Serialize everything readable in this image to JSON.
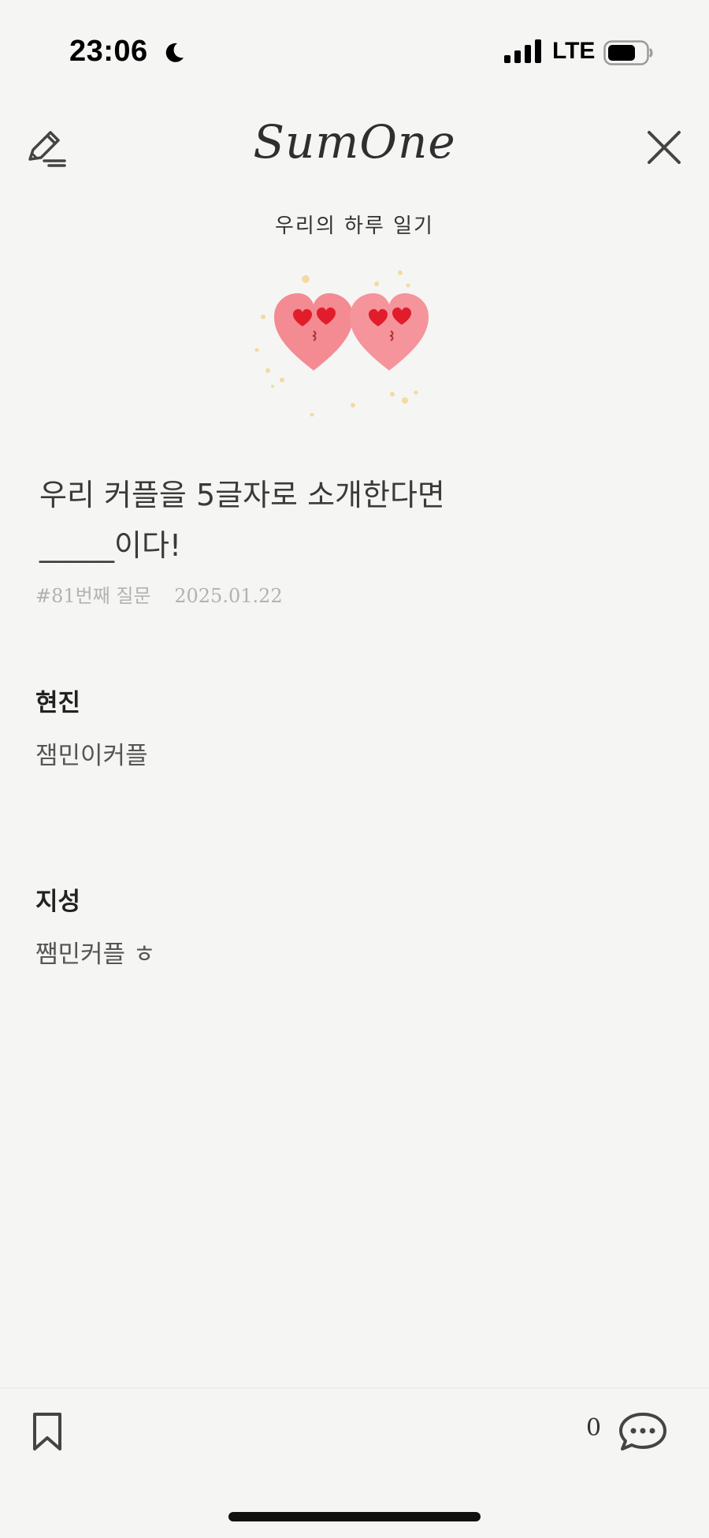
{
  "status_bar": {
    "time": "23:06",
    "network": "LTE",
    "moon_icon": "moon-icon",
    "signal_icon": "signal-icon",
    "battery_icon": "battery-icon"
  },
  "header": {
    "logo": "SumOne",
    "edit_icon": "pencil-edit-icon",
    "close_icon": "close-icon"
  },
  "subtitle": "우리의 하루 일기",
  "illustration": "heart-faces-icon",
  "question": {
    "line1": "우리 커플을 5글자로 소개한다면",
    "line2": "_____이다!",
    "number": "#81번째 질문",
    "date": "2025.01.22"
  },
  "answers": [
    {
      "name": "현진",
      "text": "잼민이커플"
    },
    {
      "name": "지성",
      "text": "쨈민커플 ㅎ"
    }
  ],
  "bottom_bar": {
    "bookmark_icon": "bookmark-icon",
    "comment_count": "0",
    "comment_icon": "comment-bubble-icon"
  },
  "colors": {
    "background": "#f5f5f4",
    "heart": "#f48a92",
    "heart_eyes": "#e11d2b",
    "muted_text": "#b2b2b2"
  }
}
